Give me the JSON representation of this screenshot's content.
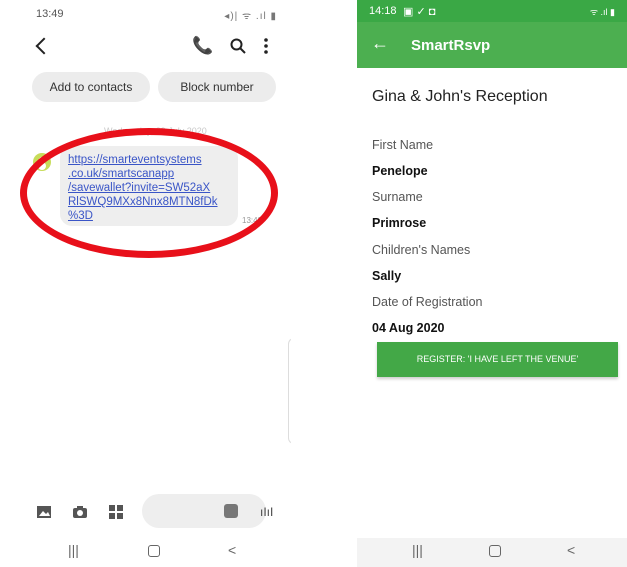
{
  "left_phone": {
    "status_time": "13:49",
    "status_icons": "◂)| ᯤ .ıl ▮",
    "header": {
      "back_icon": "chevron-left-icon",
      "call_icon": "phone-icon",
      "search_icon": "search-icon",
      "more_icon": "more-vertical-icon"
    },
    "add_contacts_label": "Add to contacts",
    "block_number_label": "Block number",
    "date_separator": "Wednesday, 29 July 2020",
    "message": {
      "link_text": "https://smarteventsystems\n.co.uk/smartscanapp\n/savewallet?invite=SW52aX\nRlSWQ9MXx8Nnx8MTN8fDk\n%3D",
      "time": "13:48"
    },
    "highlight_color": "#e8101a",
    "bottom_icons": [
      "gallery-icon",
      "camera-icon",
      "apps-icon",
      "sticker-icon",
      "voice-icon"
    ],
    "nav": {
      "recents": "|||",
      "home": "◯",
      "back": "<"
    }
  },
  "right_phone": {
    "status_time": "14:18",
    "status_icons_left": "▣ ✓ ◘",
    "status_icons_right": "ᯤ .ıl ▮",
    "app_title": "SmartRsvp",
    "event_title": "Gina & John's Reception",
    "fields": [
      {
        "label": "First Name",
        "value": "Penelope"
      },
      {
        "label": "Surname",
        "value": "Primrose"
      },
      {
        "label": "Children's Names",
        "value": "Sally"
      },
      {
        "label": "Date of Registration",
        "value": "04 Aug 2020"
      }
    ],
    "register_button": "REGISTER: 'I HAVE LEFT THE VENUE'",
    "brand_color": "#4caf50",
    "nav": {
      "recents": "|||",
      "home": "◯",
      "back": "<"
    }
  }
}
